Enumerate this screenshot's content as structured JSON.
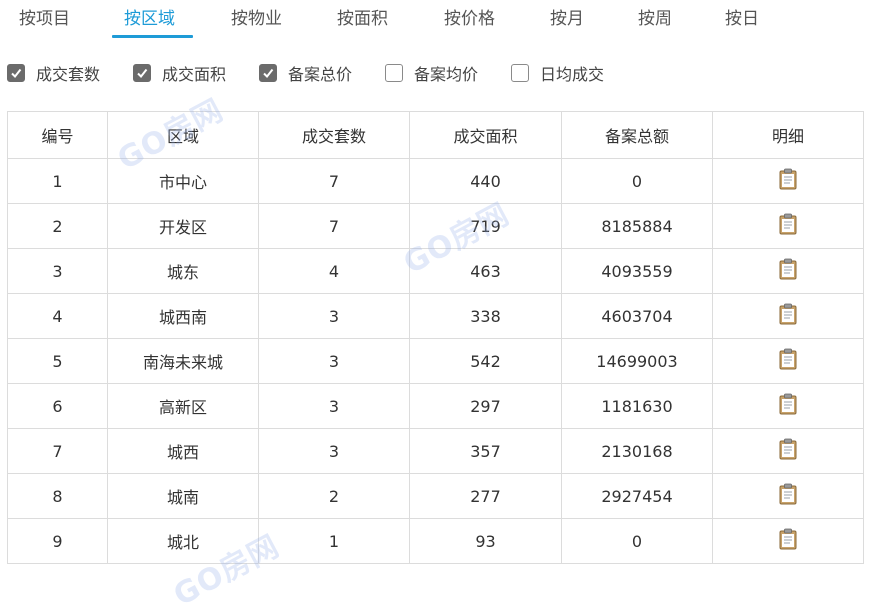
{
  "tabs": [
    {
      "label": "按项目",
      "active": false
    },
    {
      "label": "按区域",
      "active": true
    },
    {
      "label": "按物业",
      "active": false
    },
    {
      "label": "按面积",
      "active": false
    },
    {
      "label": "按价格",
      "active": false
    },
    {
      "label": "按月",
      "active": false
    },
    {
      "label": "按周",
      "active": false
    },
    {
      "label": "按日",
      "active": false
    }
  ],
  "filters": [
    {
      "label": "成交套数",
      "checked": true
    },
    {
      "label": "成交面积",
      "checked": true
    },
    {
      "label": "备案总价",
      "checked": true
    },
    {
      "label": "备案均价",
      "checked": false
    },
    {
      "label": "日均成交",
      "checked": false
    }
  ],
  "table": {
    "headers": [
      "编号",
      "区域",
      "成交套数",
      "成交面积",
      "备案总额",
      "明细"
    ],
    "rows": [
      {
        "no": "1",
        "area": "市中心",
        "count": "7",
        "size": "440",
        "total": "0",
        "detail_icon": "clipboard-icon"
      },
      {
        "no": "2",
        "area": "开发区",
        "count": "7",
        "size": "719",
        "total": "8185884",
        "detail_icon": "clipboard-icon"
      },
      {
        "no": "3",
        "area": "城东",
        "count": "4",
        "size": "463",
        "total": "4093559",
        "detail_icon": "clipboard-icon"
      },
      {
        "no": "4",
        "area": "城西南",
        "count": "3",
        "size": "338",
        "total": "4603704",
        "detail_icon": "clipboard-icon"
      },
      {
        "no": "5",
        "area": "南海未来城",
        "count": "3",
        "size": "542",
        "total": "14699003",
        "detail_icon": "clipboard-icon"
      },
      {
        "no": "6",
        "area": "高新区",
        "count": "3",
        "size": "297",
        "total": "1181630",
        "detail_icon": "clipboard-icon"
      },
      {
        "no": "7",
        "area": "城西",
        "count": "3",
        "size": "357",
        "total": "2130168",
        "detail_icon": "clipboard-icon"
      },
      {
        "no": "8",
        "area": "城南",
        "count": "2",
        "size": "277",
        "total": "2927454",
        "detail_icon": "clipboard-icon"
      },
      {
        "no": "9",
        "area": "城北",
        "count": "1",
        "size": "93",
        "total": "0",
        "detail_icon": "clipboard-icon"
      }
    ]
  },
  "watermark": {
    "text": "GO房网"
  },
  "colors": {
    "accent": "#1e9bd7",
    "checkbox_checked": "#6b6b6b",
    "border": "#dcdcdc"
  }
}
